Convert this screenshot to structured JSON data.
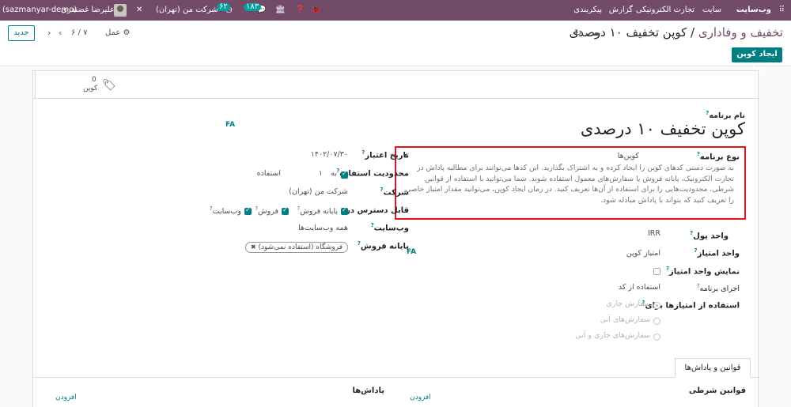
{
  "navbar": {
    "app_name": "وب‌سایت",
    "menu": [
      "سایت",
      "تجارت الکترونیکی",
      "گزارش",
      "پیکربندی"
    ],
    "db_name": "(sazmanyar-demo)",
    "user_name": "علیرضا غضنفری",
    "company": "شرکت من (تهران)",
    "activity_count": "۶۲",
    "message_count": "۱۸۳",
    "bg_color": "#714b67"
  },
  "control_panel": {
    "breadcrumb_parent": "تخفیف و وفاداری",
    "breadcrumb_sep": "/",
    "breadcrumb_current": "کوپن تخفیف ۱۰ درصدی",
    "new_label": "جدید",
    "pager": "۷ / ۶",
    "action_label": "عمل",
    "generate_coupons_label": "ایجاد کوپن ها"
  },
  "smart_button": {
    "count": "0",
    "label": "کوپن"
  },
  "form": {
    "program_name_label": "نام برنامه",
    "program_name": "کوپن تخفیف ۱۰ درصدی",
    "lang_tag": "FA",
    "program_type_label": "نوع برنامه",
    "program_type_value": "کوپن‌ها",
    "program_type_description": "به صورت دستی کدهای کوپن را ایجاد کرده و به اشتراک بگذارید. این کدها می‌توانند برای مطالبه پاداش در تجارت الکترونیک، پایانه فروش یا سفارش‌های معمول استفاده شوند. شما می‌توانید با استفاده از قوانین شرطی، محدودیت‌هایی را برای استفاده از آن‌ها تعریف کنید. در زمان ایجاد کوپن، می‌توانید مقدار امتیاز خاصی را تعریف کنید که بتواند با پاداش مبادله شود.",
    "currency_label": "واحد پول",
    "currency_value": "IRR",
    "point_unit_label": "واحد امتیاز",
    "point_unit_value": "امتیاز کوپن",
    "point_unit_lang": "FA",
    "show_point_unit_label": "نمایش واحد امتیاز",
    "trigger_label": "اجرای برنامه",
    "trigger_value": "استفاده از کد",
    "applies_on_label": "استفاده از امتیازها برای",
    "applies_on_options": [
      "سفارش جاری",
      "سفارش‌های آتی",
      "سفارش‌های جاری و آتی"
    ],
    "validity_label": "تاریخ اعتبار",
    "validity_value": "۱۴۰۲/۰۷/۳۰",
    "usage_limit_label": "محدودیت استفاده",
    "usage_limit_prefix": "به",
    "usage_limit_value": "۱",
    "usage_limit_suffix": "استفاده",
    "company_label": "شرکت",
    "company_value": "شرکت من (تهران)",
    "available_on_label": "قابل دسترس در",
    "available_on_options": [
      "پایانه فروش",
      "فروش",
      "وب‌سایت"
    ],
    "website_label": "وب‌سایت",
    "website_value": "همه وب‌سایت‌ها",
    "pos_label": "پایانه فروش",
    "pos_tag": "فروشگاه (استفاده نمی‌شود)"
  },
  "tabs": {
    "rules_rewards": "قوانین و پاداش‌ها",
    "conditional_rules": "قوانین شرطی",
    "rewards": "پاداش‌ها",
    "add_label": "افزودن"
  },
  "colors": {
    "accent": "#017e84",
    "highlight_border": "#e3141c"
  }
}
